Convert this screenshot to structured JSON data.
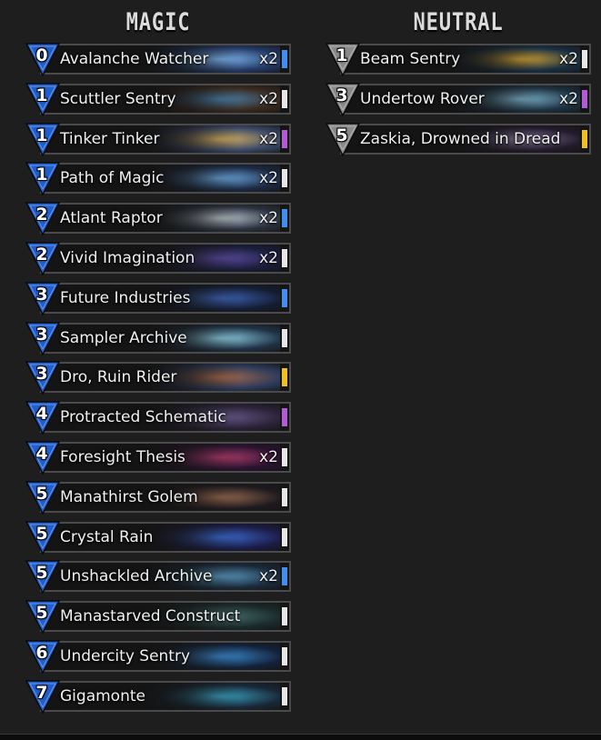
{
  "colors": {
    "magic_gem": "#1f5fd0",
    "neutral_gem": "#8a8a8a",
    "rarity_common": "#e6e6e6",
    "rarity_rare": "#3f8ef0",
    "rarity_epic": "#b35bd6",
    "rarity_legendary": "#f0c020"
  },
  "magic": {
    "title": "MAGIC",
    "cards": [
      {
        "cost": "0",
        "name": "Avalanche Watcher",
        "qty": "x2",
        "rarity": "rare",
        "art": [
          "#243a66",
          "#7fb6f0"
        ]
      },
      {
        "cost": "1",
        "name": "Scuttler Sentry",
        "qty": "x2",
        "rarity": "common",
        "art": [
          "#3a2a20",
          "#4a7fa8"
        ]
      },
      {
        "cost": "1",
        "name": "Tinker Tinker",
        "qty": "x2",
        "rarity": "epic",
        "art": [
          "#3b4a6a",
          "#d9b060"
        ]
      },
      {
        "cost": "1",
        "name": "Path of Magic",
        "qty": "x2",
        "rarity": "common",
        "art": [
          "#1d2a44",
          "#6aa8e0"
        ]
      },
      {
        "cost": "2",
        "name": "Atlant Raptor",
        "qty": "x2",
        "rarity": "rare",
        "art": [
          "#2b3340",
          "#b9c2cc"
        ]
      },
      {
        "cost": "2",
        "name": "Vivid Imagination",
        "qty": "x2",
        "rarity": "common",
        "art": [
          "#1a1e3a",
          "#5a4aa0"
        ]
      },
      {
        "cost": "3",
        "name": "Future Industries",
        "qty": "",
        "rarity": "rare",
        "art": [
          "#141d33",
          "#3d63b8"
        ]
      },
      {
        "cost": "3",
        "name": "Sampler Archive",
        "qty": "",
        "rarity": "common",
        "art": [
          "#203246",
          "#8fd2e8"
        ]
      },
      {
        "cost": "3",
        "name": "Dro, Ruin Rider",
        "qty": "",
        "rarity": "legendary",
        "art": [
          "#2d3a5a",
          "#a86a4a"
        ]
      },
      {
        "cost": "4",
        "name": "Protracted Schematic",
        "qty": "",
        "rarity": "epic",
        "art": [
          "#2a2238",
          "#6a5a8a"
        ]
      },
      {
        "cost": "4",
        "name": "Foresight Thesis",
        "qty": "x2",
        "rarity": "common",
        "art": [
          "#2a1430",
          "#b03a6a"
        ]
      },
      {
        "cost": "5",
        "name": "Manathirst Golem",
        "qty": "",
        "rarity": "common",
        "art": [
          "#1e1a1e",
          "#9a6a50"
        ]
      },
      {
        "cost": "5",
        "name": "Crystal Rain",
        "qty": "",
        "rarity": "common",
        "art": [
          "#1c1c48",
          "#3a6ad0"
        ]
      },
      {
        "cost": "5",
        "name": "Unshackled Archive",
        "qty": "x2",
        "rarity": "rare",
        "art": [
          "#1a2a3a",
          "#5a9ac0"
        ]
      },
      {
        "cost": "5",
        "name": "Manastarved Construct",
        "qty": "",
        "rarity": "common",
        "art": [
          "#1a2a2a",
          "#4a7070"
        ]
      },
      {
        "cost": "6",
        "name": "Undercity Sentry",
        "qty": "",
        "rarity": "common",
        "art": [
          "#13223a",
          "#3a8ad0"
        ]
      },
      {
        "cost": "7",
        "name": "Gigamonte",
        "qty": "",
        "rarity": "common",
        "art": [
          "#182838",
          "#3aa0c0"
        ]
      }
    ]
  },
  "neutral": {
    "title": "NEUTRAL",
    "cards": [
      {
        "cost": "1",
        "name": "Beam Sentry",
        "qty": "x2",
        "rarity": "common",
        "art": [
          "#1a3044",
          "#d0a030"
        ]
      },
      {
        "cost": "3",
        "name": "Undertow Rover",
        "qty": "x2",
        "rarity": "epic",
        "art": [
          "#1d3242",
          "#7ab0c8"
        ]
      },
      {
        "cost": "5",
        "name": "Zaskia, Drowned in Dread",
        "qty": "",
        "rarity": "legendary",
        "art": [
          "#221a2a",
          "#8a7aa0"
        ]
      }
    ]
  }
}
